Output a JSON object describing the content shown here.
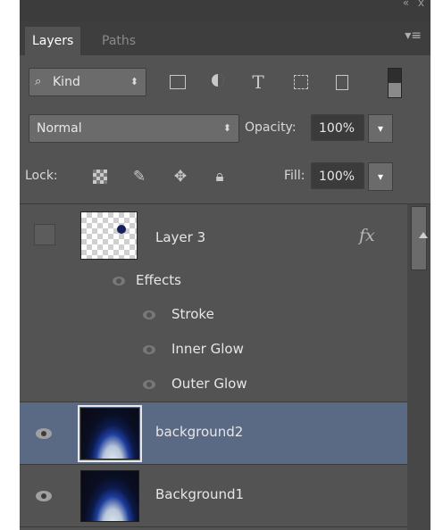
{
  "tabs": {
    "layers": "Layers",
    "paths": "Paths",
    "menu_icon": "panel-menu-icon",
    "window_controls": "« x"
  },
  "filter": {
    "search_icon": "⌕",
    "kind_label": "Kind",
    "updown": "⬍",
    "icons": [
      "pixel-filter-icon",
      "adjustment-filter-icon",
      "type-filter-icon",
      "shape-filter-icon",
      "smart-object-filter-icon",
      "filter-toggle-icon"
    ],
    "type_glyph": "T"
  },
  "blend": {
    "mode": "Normal",
    "updown": "⬍",
    "opacity_label": "Opacity:",
    "opacity_value": "100%",
    "dropdown_glyph": "▾"
  },
  "lock": {
    "label": "Lock:",
    "paint_glyph": "✎",
    "move_glyph": "✥",
    "all_glyph": "🔒︎",
    "fill_label": "Fill:",
    "fill_value": "100%",
    "dropdown_glyph": "▾"
  },
  "layers": [
    {
      "name": "Layer 3",
      "visible": false,
      "fx": "fx",
      "effects_label": "Effects",
      "effects": [
        "Stroke",
        "Inner Glow",
        "Outer Glow"
      ]
    },
    {
      "name": "background2",
      "visible": true,
      "selected": true
    },
    {
      "name": "Background1",
      "visible": true,
      "selected": false
    }
  ],
  "colors": {
    "panel_bg": "#535353",
    "selected_row": "#5a6a84",
    "tab_bar": "#3e3e3e"
  }
}
